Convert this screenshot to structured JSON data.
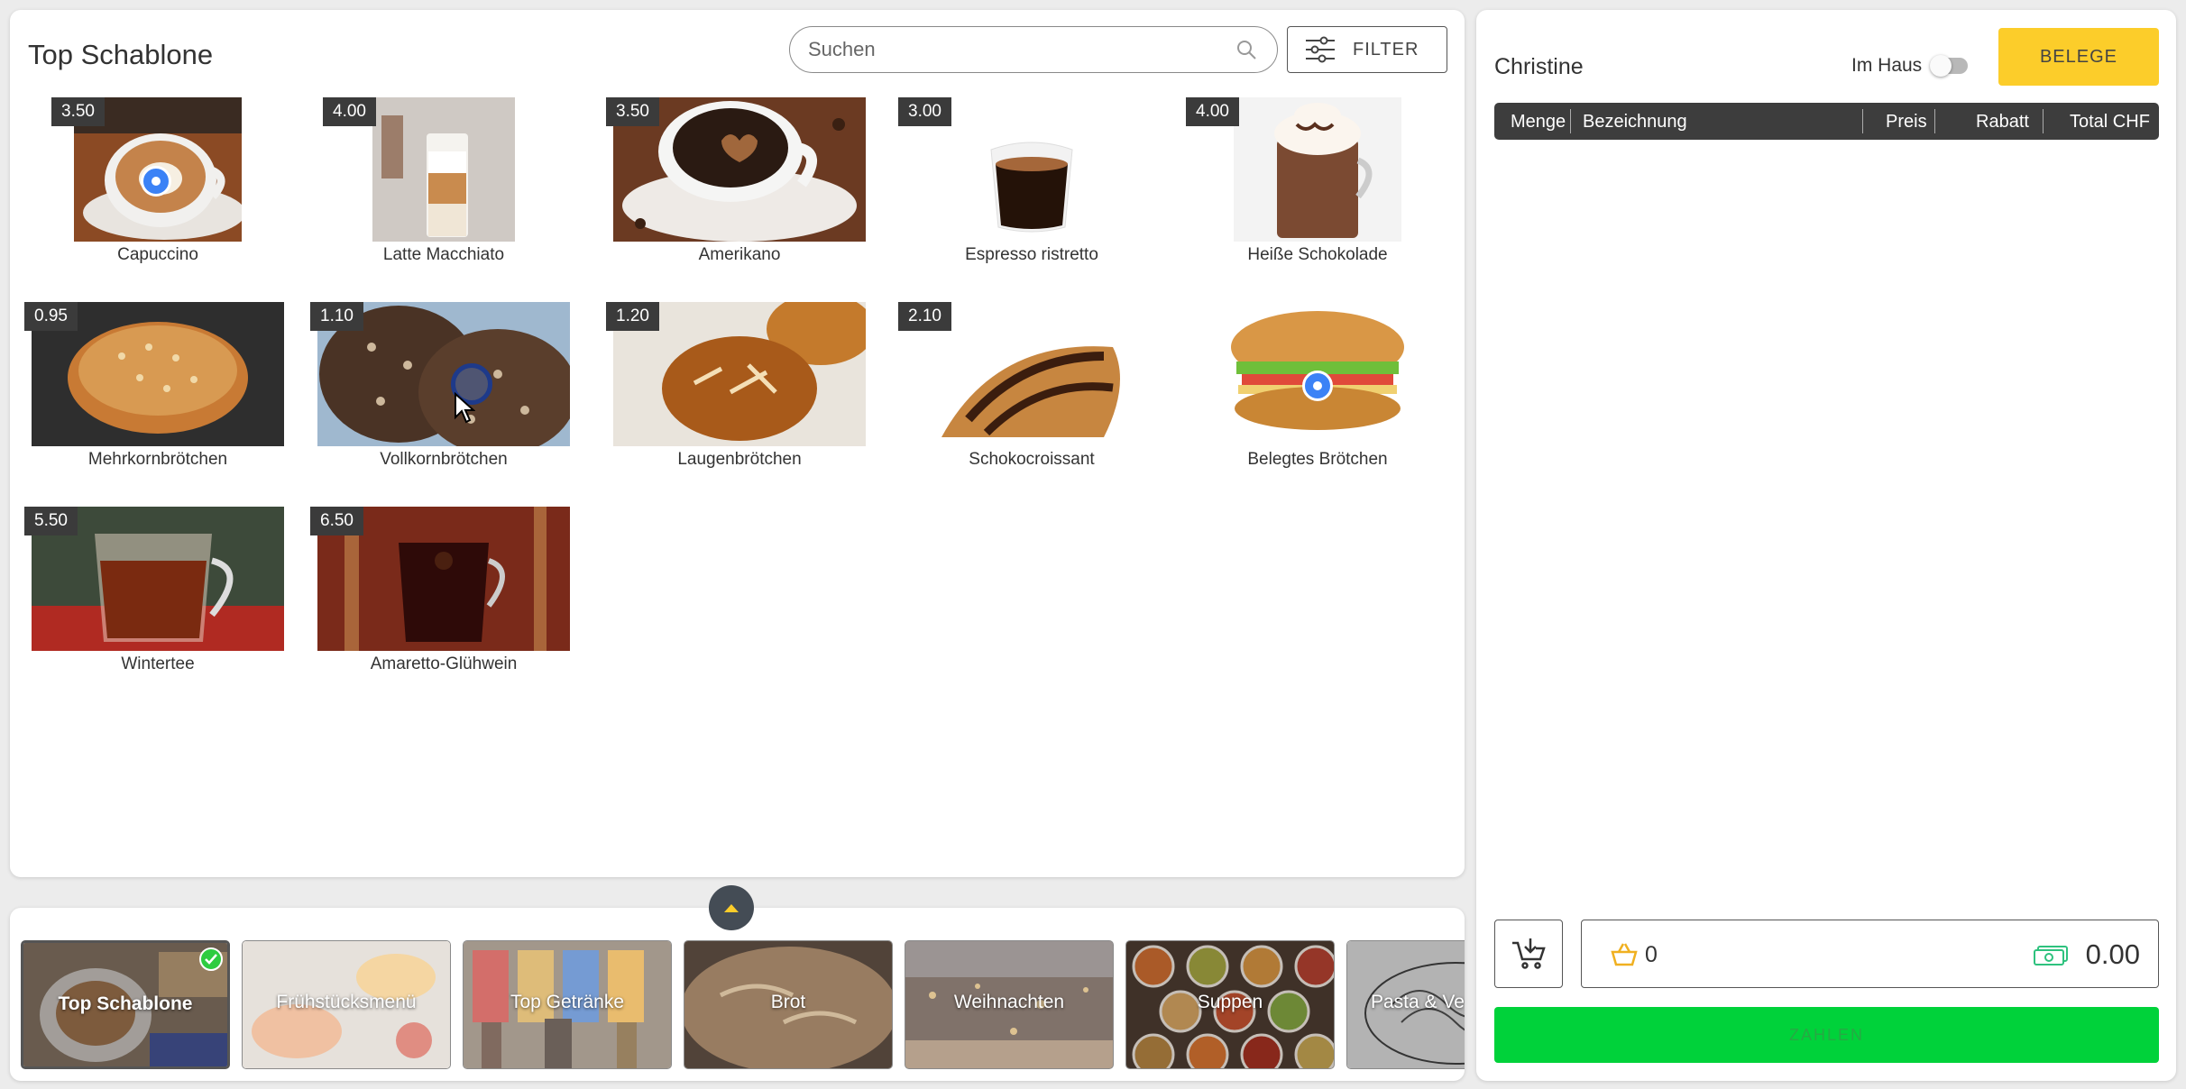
{
  "main": {
    "title": "Top Schablone",
    "search": {
      "placeholder": "Suchen",
      "value": ""
    },
    "filter_label": "FILTER",
    "products": [
      {
        "name": "Capuccino",
        "price": "3.50",
        "image": "cappuccino-photo",
        "marker": true
      },
      {
        "name": "Latte Macchiato",
        "price": "4.00",
        "image": "latte-macchiato-photo"
      },
      {
        "name": "Amerikano",
        "price": "3.50",
        "image": "americano-photo"
      },
      {
        "name": "Espresso ristretto",
        "price": "3.00",
        "image": "espresso-photo"
      },
      {
        "name": "Heiße Schokolade",
        "price": "4.00",
        "image": "hot-chocolate-photo"
      },
      {
        "name": "Mehrkornbrötchen",
        "price": "0.95",
        "image": "multigrain-roll-photo"
      },
      {
        "name": "Vollkornbrötchen",
        "price": "1.10",
        "image": "wholegrain-roll-photo"
      },
      {
        "name": "Laugenbrötchen",
        "price": "1.20",
        "image": "pretzel-roll-photo"
      },
      {
        "name": "Schokocroissant",
        "price": "2.10",
        "image": "chocolate-croissant-photo"
      },
      {
        "name": "Belegtes Brötchen",
        "price": "",
        "image": "sandwich-photo",
        "marker": true
      },
      {
        "name": "Wintertee",
        "price": "5.50",
        "image": "winter-tea-photo"
      },
      {
        "name": "Amaretto-Glühwein",
        "price": "6.50",
        "image": "mulled-wine-photo"
      }
    ]
  },
  "categories": [
    {
      "label": "Top Schablone",
      "selected": true
    },
    {
      "label": "Frühstücksmenü"
    },
    {
      "label": "Top Getränke"
    },
    {
      "label": "Brot"
    },
    {
      "label": "Weihnachten"
    },
    {
      "label": "Suppen"
    },
    {
      "label": "Pasta & Ve"
    }
  ],
  "receipt": {
    "user": "Christine",
    "inhouse_label": "Im Haus",
    "inhouse_on": false,
    "belege_label": "BELEGE",
    "columns": [
      "Menge",
      "Bezeichnung",
      "Preis",
      "Rabatt",
      "Total CHF"
    ],
    "item_count": "0",
    "total": "0.00",
    "pay_label": "ZAHLEN"
  },
  "colors": {
    "accent_yellow": "#fccd2a",
    "pay_green": "#00d23a",
    "header_dark": "#3d3d3d",
    "selected_check": "#2ecc40"
  }
}
